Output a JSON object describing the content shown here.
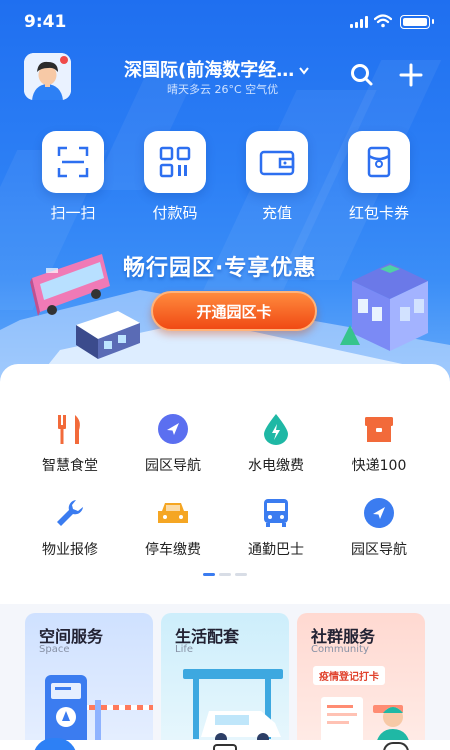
{
  "status_bar": {
    "time": "9:41"
  },
  "header": {
    "location": "深国际(前海数字经…",
    "weather": "晴天多云 26°C 空气优"
  },
  "quick_actions": [
    {
      "label": "扫一扫",
      "icon": "scan-icon"
    },
    {
      "label": "付款码",
      "icon": "qr-code-icon"
    },
    {
      "label": "充值",
      "icon": "wallet-icon"
    },
    {
      "label": "红包卡券",
      "icon": "red-packet-icon"
    }
  ],
  "banner": {
    "title": "畅行园区·专享优惠",
    "button": "开通园区卡"
  },
  "services": [
    {
      "label": "智慧食堂",
      "icon": "fork-knife-icon",
      "color": "#f26a3a"
    },
    {
      "label": "园区导航",
      "icon": "navigation-icon",
      "color": "#5b6ff0"
    },
    {
      "label": "水电缴费",
      "icon": "water-drop-icon",
      "color": "#1fb8a5"
    },
    {
      "label": "快递100",
      "icon": "parcel-box-icon",
      "color": "#f26a3a"
    },
    {
      "label": "物业报修",
      "icon": "wrench-icon",
      "color": "#3b7cf0"
    },
    {
      "label": "停车缴费",
      "icon": "car-icon",
      "color": "#f5a623"
    },
    {
      "label": "通勤巴士",
      "icon": "bus-icon",
      "color": "#3b7cf0"
    },
    {
      "label": "园区导航",
      "icon": "navigation-icon",
      "color": "#3b7cf0"
    }
  ],
  "cards": [
    {
      "title": "空间服务",
      "subtitle": "Space",
      "bg": "#dbe9ff"
    },
    {
      "title": "生活配套",
      "subtitle": "Life",
      "bg": "#d8f1fb"
    },
    {
      "title": "社群服务",
      "subtitle": "Community",
      "bg": "#ffe2dc",
      "badge": "疫情登记打卡"
    }
  ],
  "colors": {
    "brand": "#2d80f5",
    "accent": "#f04a14"
  }
}
